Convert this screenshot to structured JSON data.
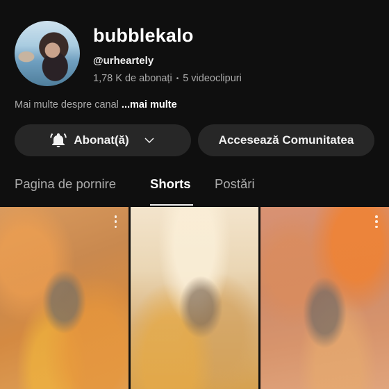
{
  "channel": {
    "name": "bubblekalo",
    "handle": "@urheartely",
    "subscribers": "1,78 K de abonați",
    "separator": "•",
    "videos": "5 videoclipuri",
    "about_text": "Mai multe despre canal",
    "about_more": "...mai multe"
  },
  "actions": {
    "subscribed_label": "Abonat(ă)",
    "community_label": "Accesează Comunitatea"
  },
  "tabs": [
    {
      "label": "Pagina de pornire",
      "active": false
    },
    {
      "label": "Shorts",
      "active": true
    },
    {
      "label": "Postări",
      "active": false
    }
  ],
  "shorts": [
    {
      "icon": "more-vert-icon"
    },
    {
      "icon": "more-vert-icon"
    },
    {
      "icon": "more-vert-icon"
    }
  ],
  "colors": {
    "background": "#0f0f0f",
    "button_bg": "#272727",
    "secondary_text": "#aaaaaa"
  }
}
